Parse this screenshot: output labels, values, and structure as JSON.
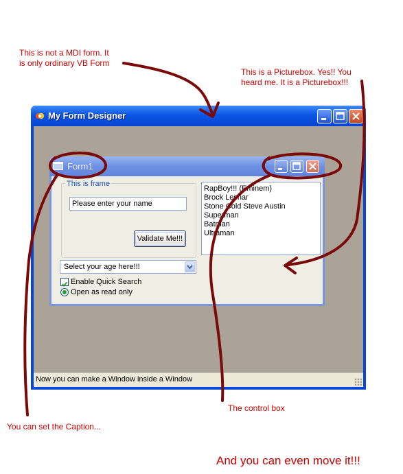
{
  "annotations": {
    "not_mdi": [
      "This is not a MDI form. It",
      "is only ordinary VB Form"
    ],
    "picturebox": [
      "This is a Picturebox. Yes!! You",
      "heard me. It is a Picturebox!!!"
    ],
    "caption": "You can set the Caption...",
    "control_box": "The control box",
    "move": "And you can even move it!!!"
  },
  "main_window": {
    "title": "My Form Designer",
    "title_icon": "vb-app-icon",
    "status_text": "Now you can make a Window inside a Window"
  },
  "form1": {
    "title": "Form1",
    "frame_caption": "This is frame",
    "name_field_value": "Please enter your name",
    "validate_button": "Validate Me!!!",
    "list_items": [
      "RapBoy!!! (Eminem)",
      "Brock Lesnar",
      "Stone Cold Steve Austin",
      "Superman",
      "Batman",
      "Ultraman"
    ],
    "age_select_value": "Select your age here!!!",
    "checkbox_label": "Enable Quick Search",
    "checkbox_checked": true,
    "radio_label": "Open as read only",
    "radio_selected": true
  },
  "colors": {
    "annotation": "#cc0000",
    "ink": "#7a0a0a",
    "xp_title_blue": "#0a55e4",
    "client_background": "#aba397"
  }
}
